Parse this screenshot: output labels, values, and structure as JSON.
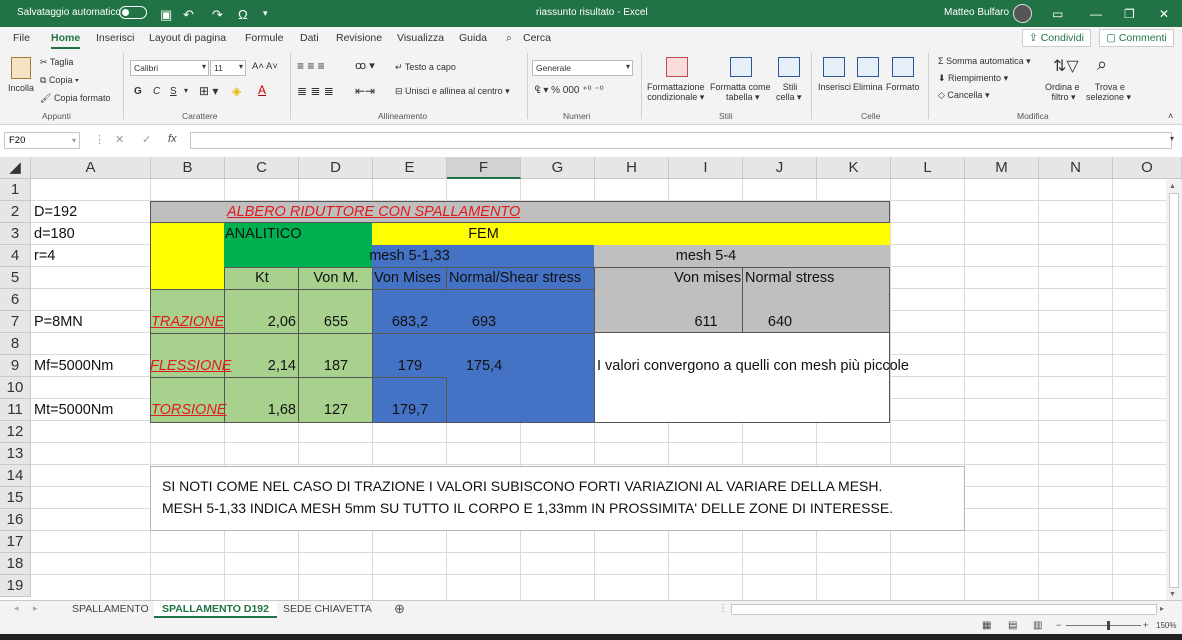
{
  "titlebar": {
    "autosave": "Salvataggio automatico",
    "doc_title": "riassunto risultato  -  Excel",
    "user": "Matteo Bulfaro"
  },
  "menu": {
    "tabs": [
      "File",
      "Home",
      "Inserisci",
      "Layout di pagina",
      "Formule",
      "Dati",
      "Revisione",
      "Visualizza",
      "Guida"
    ],
    "search": "Cerca",
    "share": "Condividi",
    "comments": "Commenti"
  },
  "ribbon": {
    "paste": "Incolla",
    "cut": "Taglia",
    "copy": "Copia",
    "format_painter": "Copia formato",
    "clipboard": "Appunti",
    "font_name": "Calibri",
    "font_size": "11",
    "bold": "G",
    "italic": "C",
    "underline": "S",
    "font_group": "Carattere",
    "wrap": "Testo a capo",
    "merge": "Unisci e allinea al centro",
    "align_group": "Allineamento",
    "number_format": "Generale",
    "number_group": "Numeri",
    "cond_format": "Formattazione",
    "cond_format2": "condizionale",
    "format_table": "Formatta come",
    "format_table2": "tabella",
    "cell_styles": "Stili",
    "cell_styles2": "cella",
    "styles_group": "Stili",
    "insert": "Inserisci",
    "delete": "Elimina",
    "format": "Formato",
    "cells_group": "Celle",
    "autosum": "Somma automatica",
    "fill": "Riempimento",
    "clear": "Cancella",
    "sort": "Ordina e",
    "sort2": "filtro",
    "find": "Trova e",
    "find2": "selezione",
    "edit_group": "Modifica"
  },
  "formula": {
    "namebox": "F20",
    "fx": "fx"
  },
  "columns": [
    "A",
    "B",
    "C",
    "D",
    "E",
    "F",
    "G",
    "H",
    "I",
    "J",
    "K",
    "L",
    "M",
    "N",
    "O"
  ],
  "rows": [
    "1",
    "2",
    "3",
    "4",
    "5",
    "6",
    "7",
    "8",
    "9",
    "10",
    "11",
    "12",
    "13",
    "14",
    "15",
    "16",
    "17",
    "18",
    "19"
  ],
  "cells": {
    "a2": "D=192",
    "a3": "d=180",
    "a4": "r=4",
    "a7": "P=8MN",
    "a9": "Mf=5000Nm",
    "a11": "Mt=5000Nm",
    "title": "ALBERO RIDUTTORE CON SPALLAMENTO",
    "analitico": "ANALITICO",
    "fem": "FEM",
    "mesh1": "mesh 5-1,33",
    "mesh2": "mesh 5-4",
    "kt": "Kt",
    "vonm": "Von M.",
    "vonmises": "Von Mises",
    "normalshear": "Normal/Shear stress",
    "vonmises2": "Von mises",
    "normalstress": "Normal stress",
    "trazione": "TRAZIONE",
    "flessione": "FLESSIONE",
    "torsione": "TORSIONE",
    "c7": "2,06",
    "d7": "655",
    "e7": "683,2",
    "f7": "693",
    "i7": "611",
    "j7": "640",
    "c9": "2,14",
    "d9": "187",
    "e9": "179",
    "f9": "175,4",
    "h9": "I valori convergono a quelli con mesh più piccole",
    "c11": "1,68",
    "d11": "127",
    "e11": "179,7"
  },
  "note": {
    "line1": "SI NOTI COME NEL CASO DI TRAZIONE I VALORI SUBISCONO FORTI VARIAZIONI AL VARIARE DELLA MESH.",
    "line2": "MESH 5-1,33 INDICA MESH 5mm SU TUTTO IL CORPO E 1,33mm IN PROSSIMITA' DELLE ZONE DI INTERESSE."
  },
  "sheets": [
    "SPALLAMENTO",
    "SPALLAMENTO D192",
    "SEDE CHIAVETTA"
  ],
  "status": {
    "zoom": "150%"
  },
  "colors": {
    "excel_green": "#217346",
    "gray": "#bdbdbd",
    "yellow": "#ffff00",
    "green": "#00b050",
    "light_green": "#a9d18e",
    "blue": "#4472c4",
    "title_red": "#e01b1b"
  }
}
